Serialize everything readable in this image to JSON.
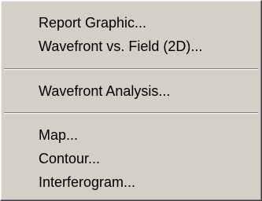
{
  "menu": {
    "items": [
      {
        "label": "Report Graphic..."
      },
      {
        "label": "Wavefront vs. Field (2D)..."
      },
      {
        "label": "Wavefront Analysis..."
      },
      {
        "label": "Map..."
      },
      {
        "label": "Contour..."
      },
      {
        "label": "Interferogram..."
      }
    ]
  }
}
